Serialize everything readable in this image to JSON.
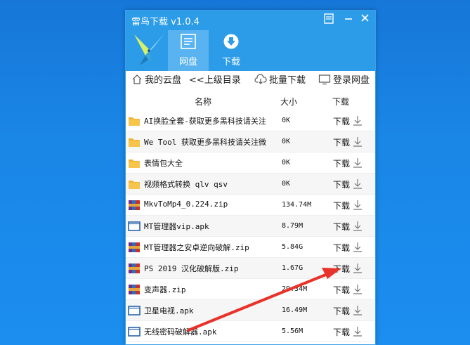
{
  "window": {
    "title": "雷鸟下载 v1.0.4"
  },
  "toolbar": {
    "tabs": [
      {
        "label": "网盘",
        "icon": "disk-icon",
        "active": true
      },
      {
        "label": "下载",
        "icon": "download-circle-icon",
        "active": false
      }
    ]
  },
  "nav": {
    "my_cloud": "我的云盘",
    "up_dir": "<<上级目录",
    "batch_download": "批量下载",
    "login": "登录网盘"
  },
  "table": {
    "headers": {
      "name": "名称",
      "size": "大小",
      "download": "下载"
    },
    "rows": [
      {
        "type": "folder",
        "name": "AI换脸全套-获取更多黑科技请关注",
        "size": "0K",
        "action": "下载"
      },
      {
        "type": "folder",
        "name": "We Tool  获取更多黑科技请关注微",
        "size": "0K",
        "action": "下载"
      },
      {
        "type": "folder",
        "name": "表情包大全",
        "size": "0K",
        "action": "下载"
      },
      {
        "type": "folder",
        "name": "视频格式转换 qlv qsv",
        "size": "0K",
        "action": "下载"
      },
      {
        "type": "archive",
        "name": "MkvToMp4_0.224.zip",
        "size": "134.74M",
        "action": "下载"
      },
      {
        "type": "apk",
        "name": "MT管理器vip.apk",
        "size": "8.79M",
        "action": "下载"
      },
      {
        "type": "archive",
        "name": "MT管理器之安卓逆向破解.zip",
        "size": "5.84G",
        "action": "下载"
      },
      {
        "type": "archive",
        "name": "PS 2019 汉化破解版.zip",
        "size": "1.67G",
        "action": "下载"
      },
      {
        "type": "archive",
        "name": "变声器.zip",
        "size": "29.34M",
        "action": "下载"
      },
      {
        "type": "apk",
        "name": "卫星电视.apk",
        "size": "16.49M",
        "action": "下载"
      },
      {
        "type": "apk",
        "name": "无线密码破解器.apk",
        "size": "5.56M",
        "action": "下载"
      }
    ]
  },
  "colors": {
    "titlebar": "#2c9ce9",
    "active_tab": "#59b3f0",
    "annotation_arrow": "#e8322a",
    "folder": "#f2b233"
  }
}
